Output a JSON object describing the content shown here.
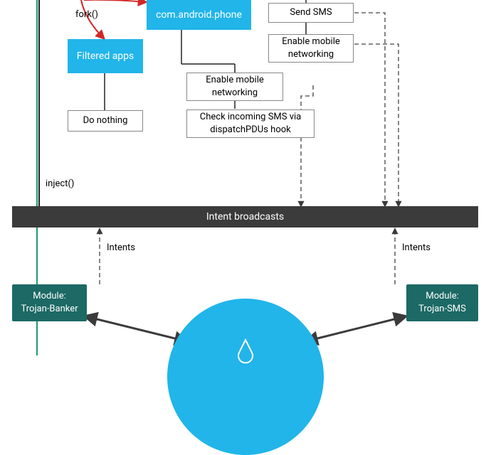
{
  "labels": {
    "fork": "fork()",
    "inject": "inject()",
    "intents_left": "Intents",
    "intents_right": "Intents"
  },
  "boxes": {
    "phone": "com.android.phone",
    "filtered": "Filtered apps",
    "donothing": "Do nothing",
    "sendsms": "Send SMS",
    "enable_net_right": "Enable mobile networking",
    "enable_net_mid": "Enable mobile networking",
    "check_sms": "Check incoming SMS via dispatchPDUs hook"
  },
  "bar": {
    "intent_broadcasts": "Intent broadcasts"
  },
  "modules": {
    "banker_line1": "Module:",
    "banker_line2": "Trojan-Banker",
    "sms_line1": "Module:",
    "sms_line2": "Trojan-SMS"
  }
}
